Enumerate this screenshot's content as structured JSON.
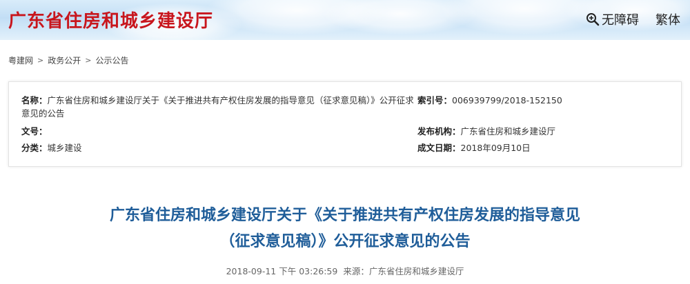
{
  "header": {
    "site_title": "广东省住房和城乡建设厅",
    "accessibility_label": "无障碍",
    "traditional_label": "繁体"
  },
  "breadcrumb": {
    "items": [
      "粤建网",
      "政务公开",
      "公示公告"
    ],
    "separator": ">"
  },
  "info": {
    "name_label": "名称：",
    "name_value": "广东省住房和城乡建设厅关于《关于推进共有产权住房发展的指导意见（征求意见稿）》公开征求意见的公告",
    "doc_no_label": "文号：",
    "doc_no_value": "",
    "category_label": "分类：",
    "category_value": "城乡建设",
    "index_label": "索引号：",
    "index_value": "006939799/2018-152150",
    "publisher_label": "发布机构：",
    "publisher_value": "广东省住房和城乡建设厅",
    "date_label": "成文日期：",
    "date_value": "2018年09月10日"
  },
  "article": {
    "title_line1": "广东省住房和城乡建设厅关于《关于推进共有产权住房发展的指导意见",
    "title_line2": "（征求意见稿）》公开征求意见的公告",
    "timestamp": "2018-09-11 下午 03:26:59",
    "source_label": "来源：",
    "source_value": "广东省住房和城乡建设厅"
  },
  "colors": {
    "site_title": "#c8161d",
    "article_title": "#1f5d99"
  }
}
